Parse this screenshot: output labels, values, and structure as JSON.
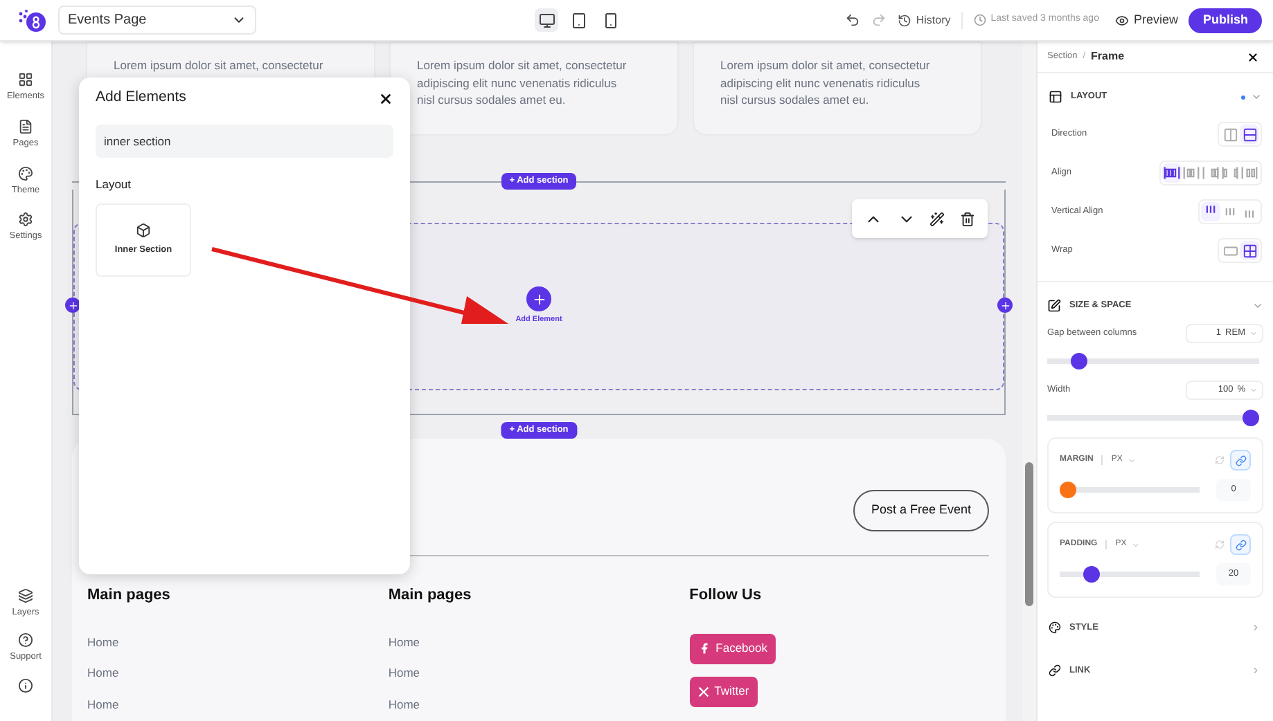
{
  "topbar": {
    "page_select": "Events Page",
    "devices": [
      {
        "kind": "desktop",
        "selected": true
      },
      {
        "kind": "tablet",
        "selected": false
      },
      {
        "kind": "phone",
        "selected": false
      }
    ],
    "history": "History",
    "last_saved": "Last saved 3 months ago",
    "preview": "Preview",
    "publish": "Publish"
  },
  "sidebar": {
    "items": [
      {
        "kind": "elements",
        "label": "Elements"
      },
      {
        "kind": "pages",
        "label": "Pages"
      },
      {
        "kind": "theme",
        "label": "Theme"
      },
      {
        "kind": "settings",
        "label": "Settings"
      }
    ],
    "bottom_items": [
      {
        "kind": "layers",
        "label": "Layers"
      },
      {
        "kind": "support",
        "label": "Support"
      },
      {
        "kind": "info"
      }
    ]
  },
  "canvas": {
    "cards": [
      {
        "lines": [
          "Lorem ipsum dolor sit amet, consectetur"
        ]
      },
      {
        "lines": [
          "Lorem ipsum dolor sit amet, consectetur",
          "adipiscing elit nunc venenatis ridiculus",
          "nisl cursus sodales amet eu."
        ]
      },
      {
        "lines": [
          "Lorem ipsum dolor sit amet, consectetur",
          "adipiscing elit nunc venenatis ridiculus",
          "nisl cursus sodales amet eu."
        ]
      }
    ],
    "add_section_top": "+ Add section",
    "add_element": "Add Element",
    "add_section_bottom": "+ Add section",
    "footer": {
      "cta": "Post a Free Event",
      "columns": [
        {
          "title": "Main pages",
          "links": [
            "Home",
            "Home",
            "Home"
          ]
        },
        {
          "title": "Main pages",
          "links": [
            "Home",
            "Home",
            "Home"
          ]
        },
        {
          "title": "Follow Us",
          "social": [
            {
              "kind": "facebook",
              "label": "Facebook"
            },
            {
              "kind": "x",
              "label": "Twitter"
            }
          ]
        }
      ]
    }
  },
  "modal": {
    "title": "Add Elements",
    "search": {
      "value": "inner section"
    },
    "group": "Layout",
    "items": [
      {
        "label": "Inner Section"
      }
    ]
  },
  "panel": {
    "breadcrumb": [
      "Section",
      "Frame"
    ],
    "breadcrumb_separator": "/",
    "layout": {
      "title": "LAYOUT",
      "rows": [
        {
          "label": "Direction",
          "options": [
            {
              "kind": "columns",
              "selected": false
            },
            {
              "kind": "rows",
              "selected": true
            }
          ]
        },
        {
          "label": "Align",
          "options": [
            {
              "kind": "start",
              "selected": true
            },
            {
              "kind": "center",
              "selected": false
            },
            {
              "kind": "end",
              "selected": false
            },
            {
              "kind": "between",
              "selected": false
            },
            {
              "kind": "around",
              "selected": false
            }
          ]
        },
        {
          "label": "Vertical Align",
          "options": [
            {
              "kind": "top",
              "selected": true
            },
            {
              "kind": "middle",
              "selected": false
            },
            {
              "kind": "bottom",
              "selected": false
            }
          ]
        },
        {
          "label": "Wrap",
          "options": [
            {
              "kind": "nowrap",
              "selected": false
            },
            {
              "kind": "wrap",
              "selected": true
            }
          ]
        }
      ]
    },
    "size": {
      "title": "SIZE & SPACE",
      "gap": {
        "label": "Gap between columns",
        "value": "1",
        "unit": "REM",
        "level": 0.12
      },
      "width": {
        "label": "Width",
        "value": "100",
        "unit": "%",
        "level": 1
      }
    },
    "spacing": [
      {
        "label": "MARGIN",
        "unit": "PX",
        "level": 0,
        "value": "0",
        "color": "#f97316"
      },
      {
        "label": "PADDING",
        "unit": "PX",
        "level": 0.19,
        "value": "20",
        "color": "#5b34e6"
      }
    ],
    "links": [
      {
        "kind": "style",
        "label": "STYLE"
      },
      {
        "kind": "link",
        "label": "LINK"
      }
    ]
  }
}
